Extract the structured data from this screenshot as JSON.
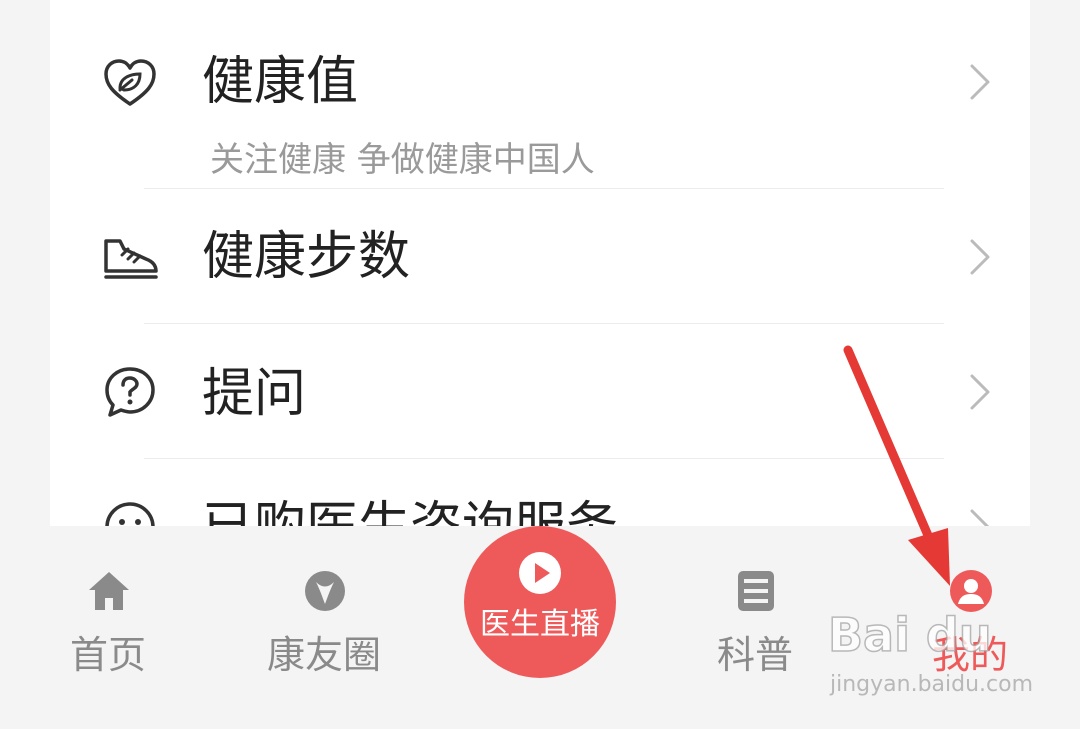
{
  "menu": {
    "items": [
      {
        "title": "健康值",
        "subtitle": "关注健康 争做健康中国人",
        "icon": "heart-leaf-icon"
      },
      {
        "title": "健康步数",
        "subtitle": "",
        "icon": "sneaker-icon"
      },
      {
        "title": "提问",
        "subtitle": "",
        "icon": "question-bubble-icon"
      },
      {
        "title": "已购医生咨询服务",
        "subtitle": "",
        "icon": "smile-icon"
      }
    ]
  },
  "tabbar": {
    "home": "首页",
    "circle": "康友圈",
    "live": "医生直播",
    "science": "科普",
    "mine": "我的"
  },
  "colors": {
    "accent": "#ee5a5a",
    "arrow": "#e53935",
    "inactive": "#8a8a8a"
  },
  "watermark": {
    "brand": "Bai du",
    "url": "jingyan.baidu.com"
  }
}
